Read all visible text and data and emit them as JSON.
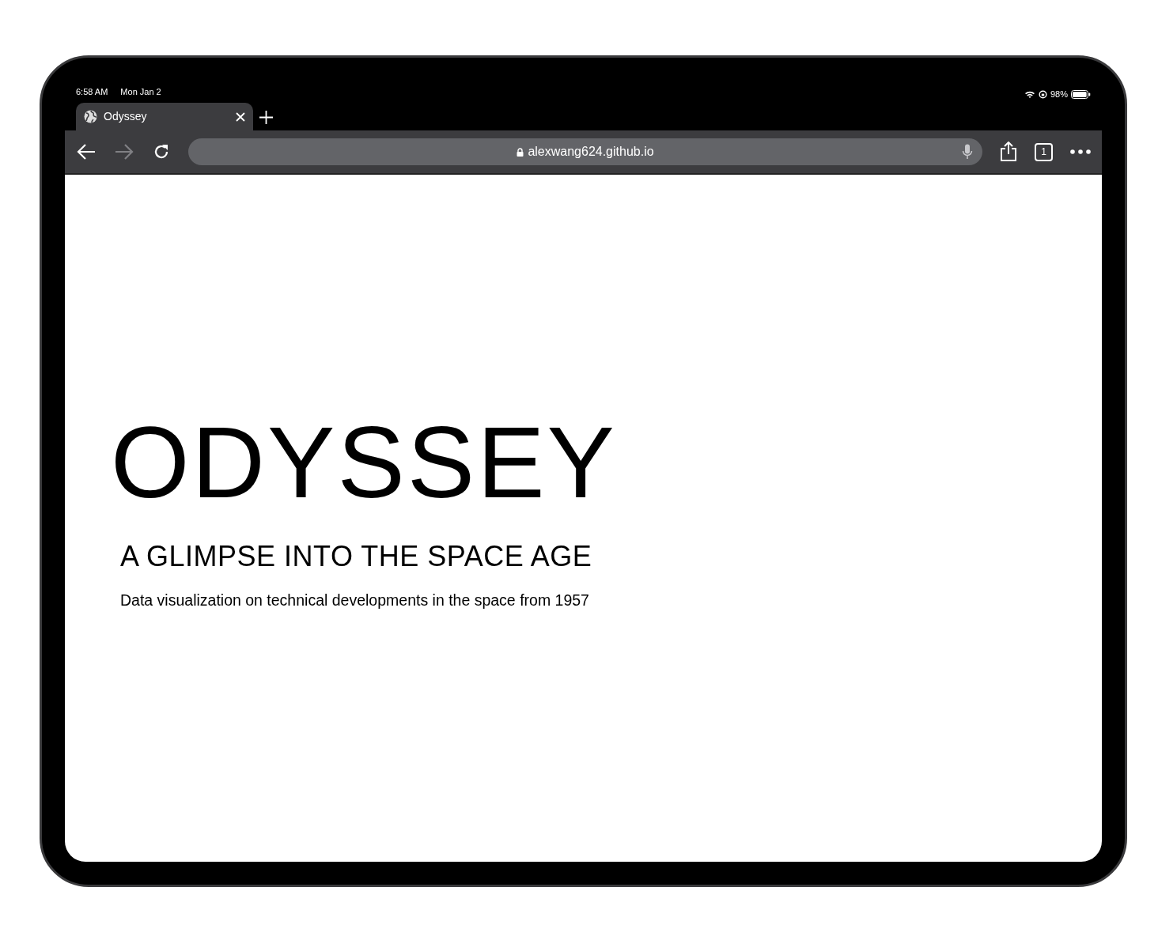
{
  "status_bar": {
    "time": "6:58 AM",
    "date": "Mon Jan 2",
    "battery": "98%",
    "level": 0.98
  },
  "tabs": [
    {
      "title": "Odyssey",
      "selected": true
    }
  ],
  "toolbar": {
    "forward_disabled": true,
    "url": "alexwang624.github.io",
    "tab_count": "1"
  },
  "page": {
    "title": "ODYSSEY",
    "subtitle": "A GLIMPSE INTO THE SPACE AGE",
    "description": "Data visualization on technical developments in the space from 1957"
  }
}
